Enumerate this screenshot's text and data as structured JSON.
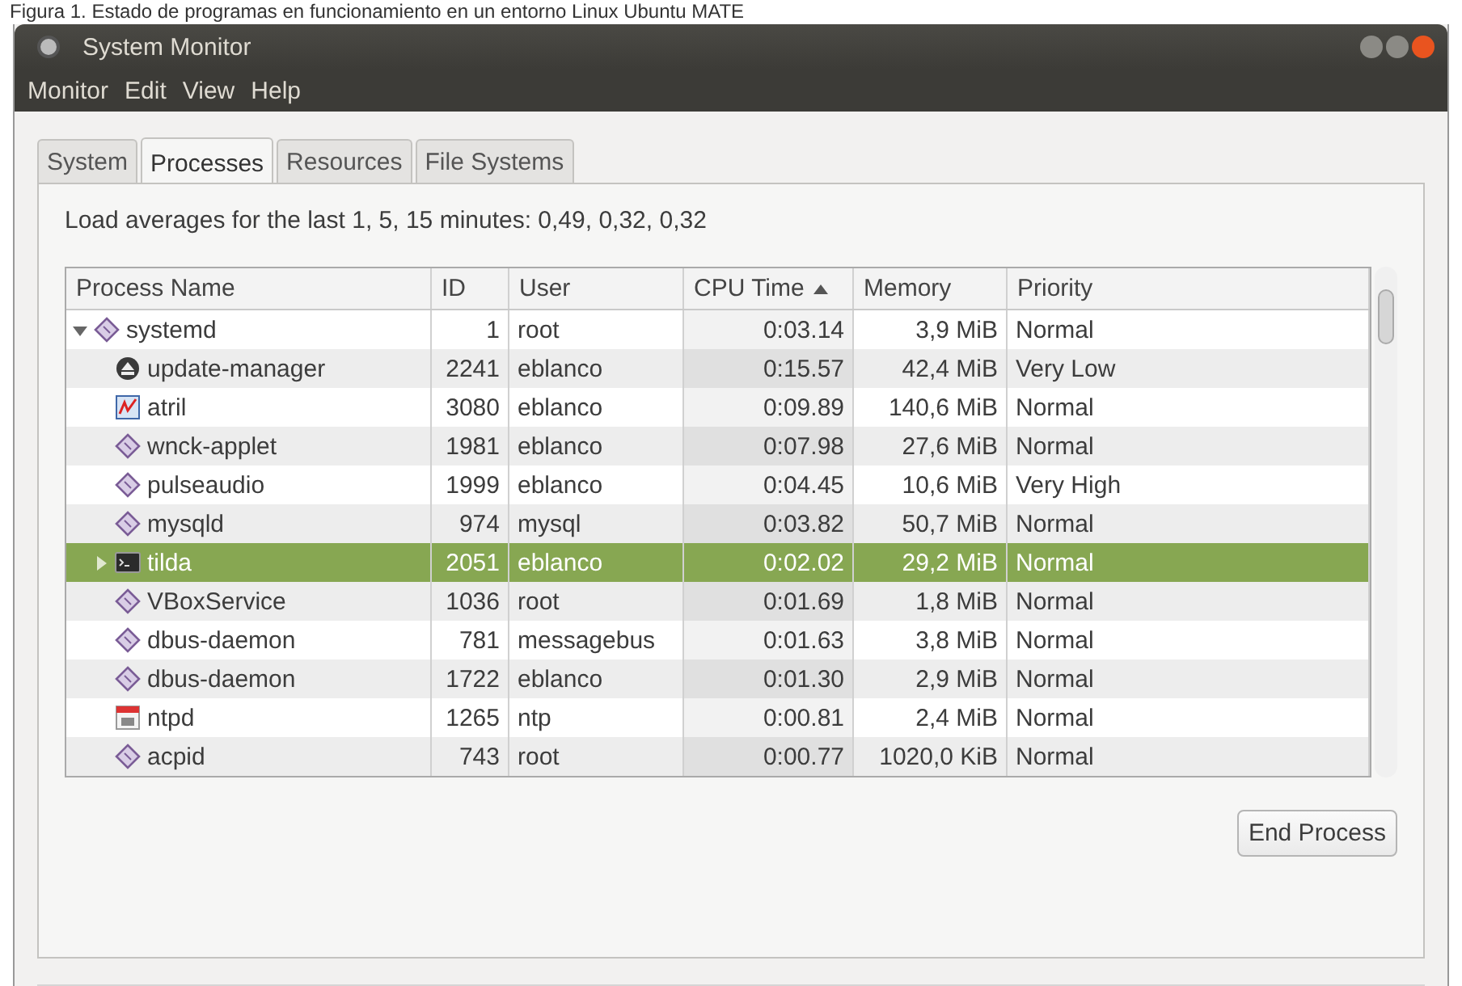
{
  "caption": "Figura 1. Estado de programas en funcionamiento en un entorno Linux Ubuntu MATE",
  "window": {
    "title": "System Monitor"
  },
  "menu": [
    "Monitor",
    "Edit",
    "View",
    "Help"
  ],
  "tabs": [
    {
      "label": "System",
      "selected": false
    },
    {
      "label": "Processes",
      "selected": true
    },
    {
      "label": "Resources",
      "selected": false
    },
    {
      "label": "File Systems",
      "selected": false
    }
  ],
  "load_averages": "Load averages for the last 1, 5, 15 minutes: 0,49, 0,32, 0,32",
  "table": {
    "columns": [
      {
        "label": "Process Name",
        "sorted": false
      },
      {
        "label": "ID",
        "sorted": false
      },
      {
        "label": "User",
        "sorted": false
      },
      {
        "label": "CPU Time",
        "sorted": true
      },
      {
        "label": "Memory",
        "sorted": false
      },
      {
        "label": "Priority",
        "sorted": false
      }
    ],
    "rows": [
      {
        "name": "systemd",
        "kind": "daemon",
        "id": "1",
        "user": "root",
        "cpu": "0:03.14",
        "memory": "3,9 MiB",
        "priority": "Normal",
        "selected": false,
        "expanded": true,
        "children": [
          {
            "name": "update-manager",
            "kind": "updater",
            "id": "2241",
            "user": "eblanco",
            "cpu": "0:15.57",
            "memory": "42,4 MiB",
            "priority": "Very Low",
            "selected": false
          },
          {
            "name": "atril",
            "kind": "document-viewer",
            "id": "3080",
            "user": "eblanco",
            "cpu": "0:09.89",
            "memory": "140,6 MiB",
            "priority": "Normal",
            "selected": false
          },
          {
            "name": "wnck-applet",
            "kind": "daemon",
            "id": "1981",
            "user": "eblanco",
            "cpu": "0:07.98",
            "memory": "27,6 MiB",
            "priority": "Normal",
            "selected": false
          },
          {
            "name": "pulseaudio",
            "kind": "daemon",
            "id": "1999",
            "user": "eblanco",
            "cpu": "0:04.45",
            "memory": "10,6 MiB",
            "priority": "Very High",
            "selected": false
          },
          {
            "name": "mysqld",
            "kind": "daemon",
            "id": "974",
            "user": "mysql",
            "cpu": "0:03.82",
            "memory": "50,7 MiB",
            "priority": "Normal",
            "selected": false
          },
          {
            "name": "tilda",
            "kind": "terminal",
            "id": "2051",
            "user": "eblanco",
            "cpu": "0:02.02",
            "memory": "29,2 MiB",
            "priority": "Normal",
            "selected": true,
            "expanded": false
          },
          {
            "name": "VBoxService",
            "kind": "daemon",
            "id": "1036",
            "user": "root",
            "cpu": "0:01.69",
            "memory": "1,8 MiB",
            "priority": "Normal",
            "selected": false
          },
          {
            "name": "dbus-daemon",
            "kind": "daemon",
            "id": "781",
            "user": "messagebus",
            "cpu": "0:01.63",
            "memory": "3,8 MiB",
            "priority": "Normal",
            "selected": false
          },
          {
            "name": "dbus-daemon",
            "kind": "daemon",
            "id": "1722",
            "user": "eblanco",
            "cpu": "0:01.30",
            "memory": "2,9 MiB",
            "priority": "Normal",
            "selected": false
          },
          {
            "name": "ntpd",
            "kind": "calendar",
            "id": "1265",
            "user": "ntp",
            "cpu": "0:00.81",
            "memory": "2,4 MiB",
            "priority": "Normal",
            "selected": false
          },
          {
            "name": "acpid",
            "kind": "daemon",
            "id": "743",
            "user": "root",
            "cpu": "0:00.77",
            "memory": "1020,0 KiB",
            "priority": "Normal",
            "selected": false
          }
        ]
      }
    ]
  },
  "end_button": "End Process"
}
